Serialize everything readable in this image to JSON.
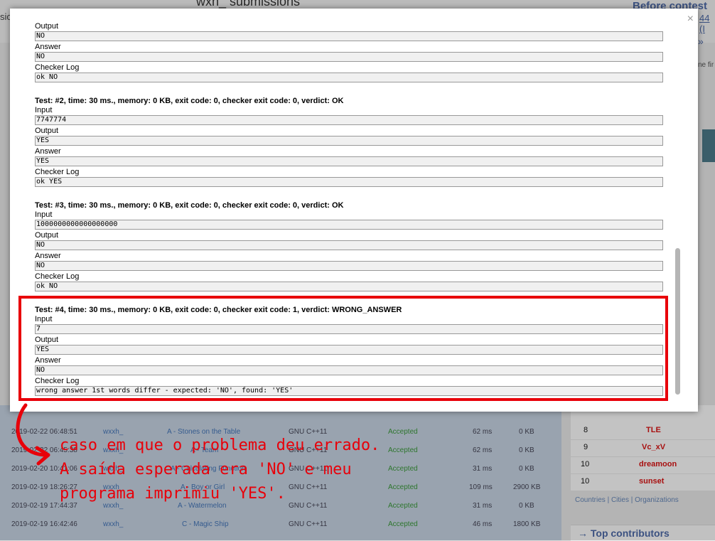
{
  "background": {
    "title": "wxh_ submissions",
    "left_fragment": "sio",
    "before_contest": "Before contest",
    "link_fragment": "44 (I",
    "arrow_link": "»",
    "text_fragment": "ne fir",
    "table_rows": [
      {
        "time": "2019-02-22 06:48:51",
        "who": "wxxh_",
        "problem": "A - Stones on the Table",
        "lang": "GNU C++11",
        "verdict": "Accepted",
        "ms": "62 ms",
        "kb": "0 KB"
      },
      {
        "time": "2019-02-22 06:45:38",
        "who": "wxxh_",
        "problem": "A - Team",
        "lang": "GNU C++11",
        "verdict": "Accepted",
        "ms": "62 ms",
        "kb": "0 KB"
      },
      {
        "time": "2019-02-20 10:41:06",
        "who": "wxxh_",
        "problem": "A - Calculating Function",
        "lang": "GNU C++11",
        "verdict": "Accepted",
        "ms": "31 ms",
        "kb": "0 KB"
      },
      {
        "time": "2019-02-19 18:26:27",
        "who": "wxxh_",
        "problem": "A - Boy or Girl",
        "lang": "GNU C++11",
        "verdict": "Accepted",
        "ms": "109 ms",
        "kb": "2900 KB"
      },
      {
        "time": "2019-02-19 17:44:37",
        "who": "wxxh_",
        "problem": "A - Watermelon",
        "lang": "GNU C++11",
        "verdict": "Accepted",
        "ms": "31 ms",
        "kb": "0 KB"
      },
      {
        "time": "2019-02-19 16:42:46",
        "who": "wxxh_",
        "problem": "C - Magic Ship",
        "lang": "GNU C++11",
        "verdict": "Accepted",
        "ms": "46 ms",
        "kb": "1800 KB"
      }
    ],
    "rank_rows": [
      {
        "rank": "8",
        "name": "TLE"
      },
      {
        "rank": "9",
        "name": "Vc_xV"
      },
      {
        "rank": "10",
        "name": "dreamoon"
      },
      {
        "rank": "10",
        "name": "sunset"
      }
    ],
    "filters": "Countries | Cities | Organizations",
    "top_contributors": "→ Top contributors"
  },
  "modal": {
    "close_label": "×",
    "tests": [
      {
        "header": "",
        "fields": [
          {
            "label": "Output",
            "value": "NO"
          },
          {
            "label": "Answer",
            "value": "NO"
          },
          {
            "label": "Checker Log",
            "value": "ok NO"
          }
        ]
      },
      {
        "header": "Test: #2, time: 30 ms., memory: 0 KB, exit code: 0, checker exit code: 0, verdict: OK",
        "fields": [
          {
            "label": "Input",
            "value": "7747774"
          },
          {
            "label": "Output",
            "value": "YES"
          },
          {
            "label": "Answer",
            "value": "YES"
          },
          {
            "label": "Checker Log",
            "value": "ok YES"
          }
        ]
      },
      {
        "header": "Test: #3, time: 30 ms., memory: 0 KB, exit code: 0, checker exit code: 0, verdict: OK",
        "fields": [
          {
            "label": "Input",
            "value": "1000000000000000000"
          },
          {
            "label": "Output",
            "value": "NO"
          },
          {
            "label": "Answer",
            "value": "NO"
          },
          {
            "label": "Checker Log",
            "value": "ok NO"
          }
        ]
      },
      {
        "header": "Test: #4, time: 30 ms., memory: 0 KB, exit code: 0, checker exit code: 1, verdict: WRONG_ANSWER",
        "fields": [
          {
            "label": "Input",
            "value": "7"
          },
          {
            "label": "Output",
            "value": "YES"
          },
          {
            "label": "Answer",
            "value": "NO"
          },
          {
            "label": "Checker Log",
            "value": "wrong answer 1st words differ - expected: 'NO', found: 'YES'"
          }
        ]
      }
    ]
  },
  "annotation": {
    "line1": "caso em que o problema deu errado.",
    "line2": "A saída esperada era 'NO' e meu",
    "line3": "programa imprimiu 'YES'.",
    "color": "#e8000a"
  }
}
